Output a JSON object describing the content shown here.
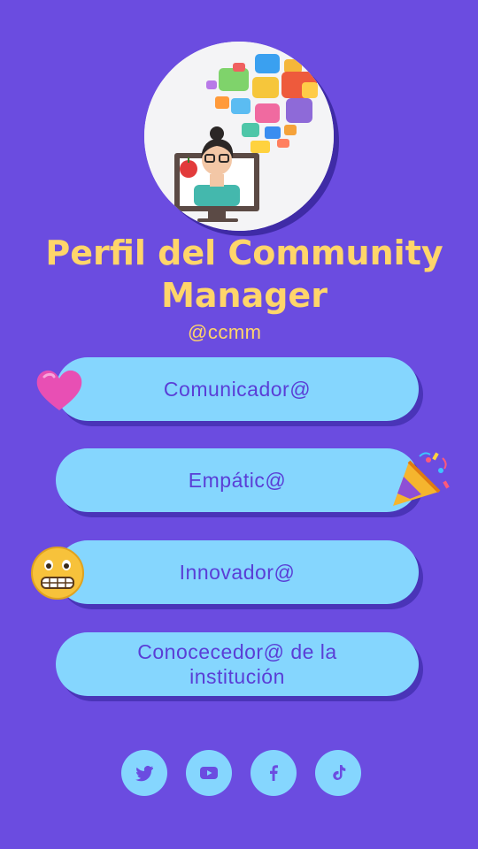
{
  "profile": {
    "title": "Perfil del Community Manager",
    "handle": "@ccmm"
  },
  "links": [
    {
      "label": "Comunicador@"
    },
    {
      "label": "Empátic@"
    },
    {
      "label": "Innovador@"
    },
    {
      "label": "Conocecedor@ de la institución"
    }
  ],
  "decorations": {
    "link_0": "heart-emoji-icon",
    "link_1": "party-popper-emoji-icon",
    "link_2": "grimacing-face-emoji-icon"
  },
  "socials": [
    {
      "icon": "twitter-icon"
    },
    {
      "icon": "youtube-icon"
    },
    {
      "icon": "facebook-icon"
    },
    {
      "icon": "tiktok-icon"
    }
  ],
  "colors": {
    "background": "#6b4ce0",
    "button": "#85d6fe",
    "button_text": "#5a3ed6",
    "title": "#ffd56a"
  }
}
